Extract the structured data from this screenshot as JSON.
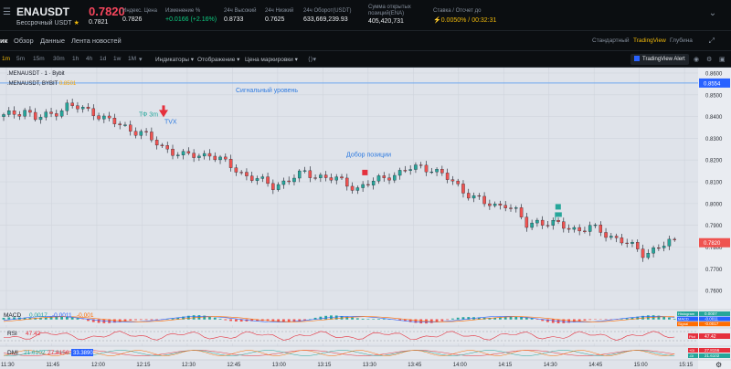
{
  "header": {
    "symbol": "ENAUSDT",
    "contract_type": "Бессрочный USDT",
    "last_price": "0.7820",
    "mark_price": "0.7821",
    "stats": [
      {
        "label": "Индекс. Цена",
        "value": "0.7826",
        "tone": "normal"
      },
      {
        "label": "Изменение %",
        "value": "+0.0166 (+2.16%)",
        "tone": "green"
      },
      {
        "label": "24ч Высокий",
        "value": "0.8733",
        "tone": "normal"
      },
      {
        "label": "24ч Низкий",
        "value": "0.7625",
        "tone": "normal"
      },
      {
        "label": "24ч Оборот(USDT)",
        "value": "633,669,239.93",
        "tone": "normal"
      },
      {
        "label": "Сумма открытых позиций(ENA)",
        "value": "405,420,731",
        "tone": "normal"
      },
      {
        "label": "Ставка / Отсчет до",
        "value": "0.0050% / 00:32:31",
        "tone": "yellow"
      }
    ]
  },
  "tabs": [
    {
      "label": "ик",
      "active": true
    },
    {
      "label": "Обзор",
      "active": false
    },
    {
      "label": "Данные",
      "active": false
    },
    {
      "label": "Лента новостей",
      "active": false
    }
  ],
  "views": [
    {
      "label": "Стандартный",
      "active": false
    },
    {
      "label": "TradingView",
      "active": true
    },
    {
      "label": "Глубина",
      "active": false
    }
  ],
  "toolbar": {
    "timeframes": [
      "1m",
      "5m",
      "15m",
      "30m",
      "1h",
      "4h",
      "1d",
      "1w",
      "1M"
    ],
    "active_timeframe": "1m",
    "indicators": "Индикаторы",
    "display": "Отображение",
    "price_type": "Цена маркировки",
    "alert": "TradingView Alert"
  },
  "chart": {
    "legend_line1": ".MENAUSDT · 1 · Bybit",
    "legend_line2": ".MENAUSDT, BYBIT",
    "legend_value": "0.8501",
    "annotations": {
      "signal_level": "Сигнальный уровень",
      "tf_label": "ТФ 3m",
      "tvx": "TVX",
      "add_position": "Добор позиции"
    },
    "signal_price_tag": "0.8554",
    "last_price_tag": "0.7820",
    "macd": {
      "name": "MACD",
      "values": [
        "0.0017",
        "-0.0011",
        "-0.001"
      ],
      "tags": [
        {
          "name": "Histogram",
          "value": "0.0007"
        },
        {
          "name": "MACD",
          "value": "-0.0011"
        },
        {
          "name": "Signal",
          "value": "-0.0017"
        }
      ]
    },
    "rsi": {
      "name": "RSI",
      "value": "47.42",
      "tag": "47.42"
    },
    "dmi": {
      "name": "DMI",
      "values": [
        "21.6102",
        "27.8156",
        "33.3890"
      ],
      "tags": [
        {
          "name": "+DI",
          "value": "27.8156"
        },
        {
          "name": "-DI",
          "value": "21.6102"
        }
      ]
    }
  },
  "chart_data": {
    "type": "candlestick",
    "ylim": [
      0.7525,
      0.8625
    ],
    "yticks": [
      "0.8600",
      "0.8500",
      "0.8400",
      "0.8300",
      "0.8200",
      "0.8100",
      "0.8000",
      "0.7900",
      "0.7800",
      "0.7700",
      "0.7600"
    ],
    "xticks": [
      "11:30",
      "11:45",
      "12:00",
      "12:15",
      "12:30",
      "12:45",
      "13:00",
      "13:15",
      "13:30",
      "13:45",
      "14:00",
      "14:15",
      "14:30",
      "14:45",
      "15:00",
      "15:15"
    ],
    "signal_level": 0.8554,
    "close_path": [
      [
        0,
        0.84
      ],
      [
        4,
        0.843
      ],
      [
        6,
        0.839
      ],
      [
        9,
        0.841
      ],
      [
        12,
        0.845
      ],
      [
        14,
        0.844
      ],
      [
        17,
        0.842
      ],
      [
        20,
        0.838
      ],
      [
        22,
        0.836
      ],
      [
        24,
        0.834
      ],
      [
        26,
        0.833
      ],
      [
        28,
        0.829
      ],
      [
        30,
        0.826
      ],
      [
        32,
        0.824
      ],
      [
        34,
        0.822
      ],
      [
        37,
        0.822
      ],
      [
        39,
        0.823
      ],
      [
        41,
        0.82
      ],
      [
        43,
        0.817
      ],
      [
        45,
        0.814
      ],
      [
        47,
        0.812
      ],
      [
        49,
        0.81
      ],
      [
        51,
        0.808
      ],
      [
        53,
        0.81
      ],
      [
        55,
        0.812
      ],
      [
        57,
        0.814
      ],
      [
        59,
        0.813
      ],
      [
        61,
        0.812
      ],
      [
        63,
        0.811
      ],
      [
        65,
        0.809
      ],
      [
        67,
        0.807
      ],
      [
        69,
        0.809
      ],
      [
        71,
        0.811
      ],
      [
        73,
        0.813
      ],
      [
        75,
        0.814
      ],
      [
        77,
        0.816
      ],
      [
        79,
        0.817
      ],
      [
        81,
        0.816
      ],
      [
        83,
        0.813
      ],
      [
        85,
        0.81
      ],
      [
        87,
        0.806
      ],
      [
        89,
        0.803
      ],
      [
        91,
        0.8
      ],
      [
        93,
        0.799
      ],
      [
        95,
        0.8
      ],
      [
        97,
        0.796
      ],
      [
        99,
        0.79
      ],
      [
        101,
        0.792
      ],
      [
        103,
        0.791
      ],
      [
        105,
        0.79
      ],
      [
        107,
        0.789
      ],
      [
        109,
        0.788
      ],
      [
        111,
        0.789
      ],
      [
        113,
        0.787
      ],
      [
        115,
        0.785
      ],
      [
        117,
        0.783
      ],
      [
        119,
        0.78
      ],
      [
        121,
        0.777
      ],
      [
        123,
        0.779
      ],
      [
        125,
        0.781
      ],
      [
        126,
        0.782
      ]
    ],
    "markers": [
      {
        "label": "TVX",
        "x": 23,
        "y": 0.836
      },
      {
        "label": "Добор позиции",
        "x": 67,
        "y": 0.813
      }
    ]
  }
}
